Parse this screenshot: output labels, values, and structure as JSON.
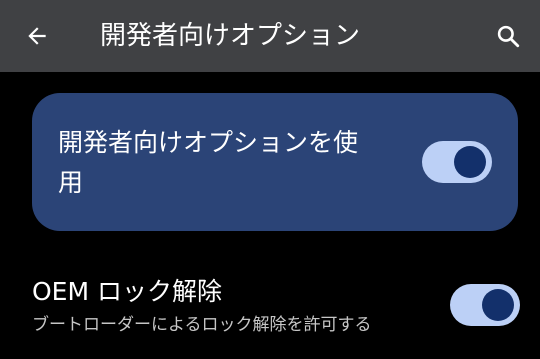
{
  "app_bar": {
    "back_icon": "arrow-back-icon",
    "title": "開発者向けオプション",
    "search_icon": "search-icon",
    "background": "#404144"
  },
  "developer_options": {
    "label": "開発者向けオプションを使用",
    "enabled": true,
    "card_color": "#2b4477"
  },
  "oem_unlock": {
    "title": "OEM ロック解除",
    "summary": "ブートローダーによるロック解除を許可する",
    "enabled": true
  },
  "colors": {
    "toggle_track_on": "#bcd0f6",
    "toggle_knob_on": "#13306b"
  }
}
